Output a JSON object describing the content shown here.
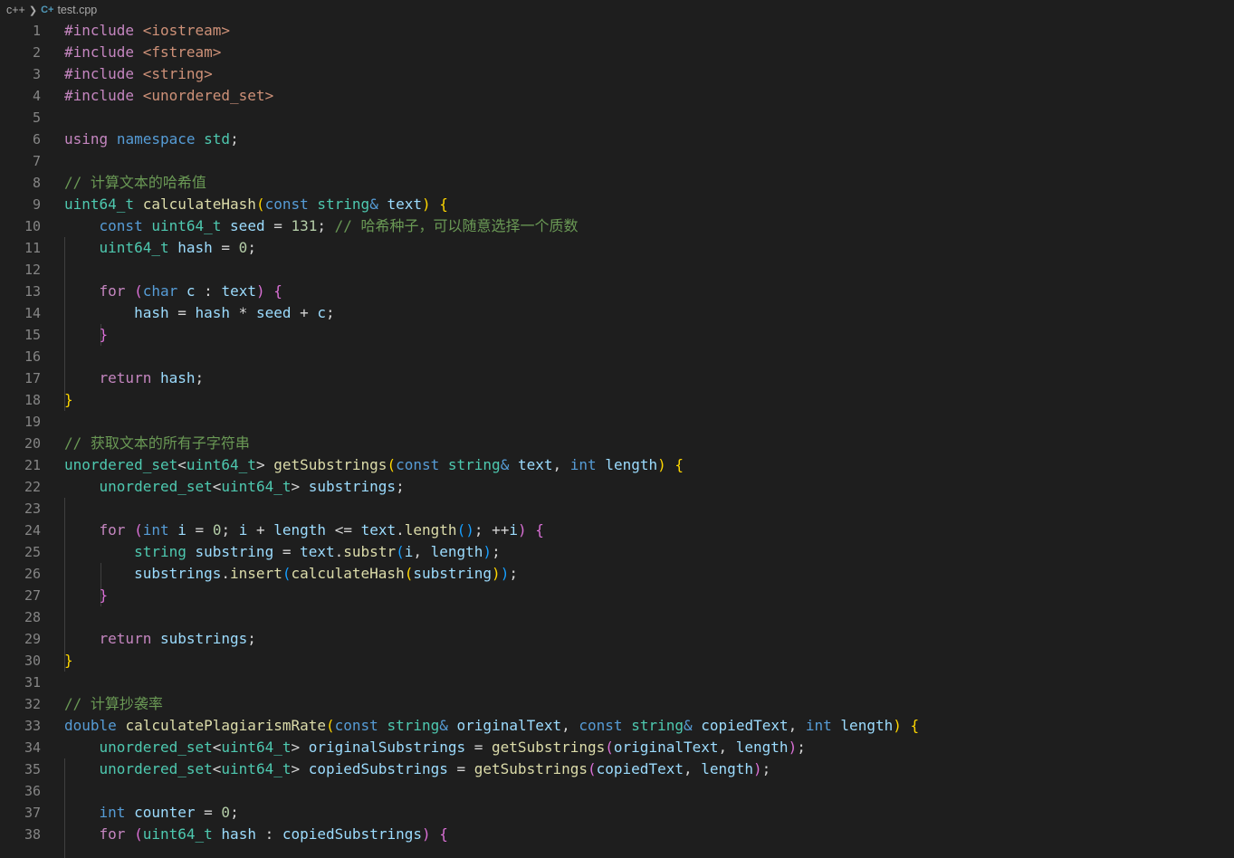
{
  "breadcrumb": {
    "folder": "c++",
    "file": "test.cpp"
  },
  "colors": {
    "background": "#1e1e1e",
    "keyword": "#569cd6",
    "control": "#c586c0",
    "type": "#4ec9b0",
    "function": "#dcdcaa",
    "variable": "#9cdcfe",
    "number": "#b5cea8",
    "string": "#ce9178",
    "comment": "#6a9955",
    "plain": "#d4d4d4"
  },
  "editor": {
    "lines": [
      {
        "n": "1",
        "tokens": [
          [
            "ctl",
            "#include"
          ],
          [
            "pl",
            " "
          ],
          [
            "str",
            "<iostream>"
          ]
        ]
      },
      {
        "n": "2",
        "tokens": [
          [
            "ctl",
            "#include"
          ],
          [
            "pl",
            " "
          ],
          [
            "str",
            "<fstream>"
          ]
        ]
      },
      {
        "n": "3",
        "tokens": [
          [
            "ctl",
            "#include"
          ],
          [
            "pl",
            " "
          ],
          [
            "str",
            "<string>"
          ]
        ]
      },
      {
        "n": "4",
        "tokens": [
          [
            "ctl",
            "#include"
          ],
          [
            "pl",
            " "
          ],
          [
            "str",
            "<unordered_set>"
          ]
        ]
      },
      {
        "n": "5",
        "tokens": []
      },
      {
        "n": "6",
        "tokens": [
          [
            "ctl",
            "using"
          ],
          [
            "pl",
            " "
          ],
          [
            "kw",
            "namespace"
          ],
          [
            "pl",
            " "
          ],
          [
            "type",
            "std"
          ],
          [
            "pl",
            ";"
          ]
        ]
      },
      {
        "n": "7",
        "tokens": []
      },
      {
        "n": "8",
        "tokens": [
          [
            "com",
            "// 计算文本的哈希值"
          ]
        ]
      },
      {
        "n": "9",
        "tokens": [
          [
            "type",
            "uint64_t"
          ],
          [
            "pl",
            " "
          ],
          [
            "fn",
            "calculateHash"
          ],
          [
            "b1",
            "("
          ],
          [
            "kw",
            "const"
          ],
          [
            "pl",
            " "
          ],
          [
            "type",
            "string"
          ],
          [
            "kw",
            "&"
          ],
          [
            "pl",
            " "
          ],
          [
            "var",
            "text"
          ],
          [
            "b1",
            ")"
          ],
          [
            "pl",
            " "
          ],
          [
            "b1",
            "{"
          ]
        ]
      },
      {
        "n": "10",
        "tokens": [
          [
            "pl",
            "    "
          ],
          [
            "kw",
            "const"
          ],
          [
            "pl",
            " "
          ],
          [
            "type",
            "uint64_t"
          ],
          [
            "pl",
            " "
          ],
          [
            "var",
            "seed"
          ],
          [
            "pl",
            " = "
          ],
          [
            "num",
            "131"
          ],
          [
            "pl",
            "; "
          ],
          [
            "com",
            "// 哈希种子，可以随意选择一个质数"
          ]
        ]
      },
      {
        "n": "11",
        "tokens": [
          [
            "pl",
            "    "
          ],
          [
            "type",
            "uint64_t"
          ],
          [
            "pl",
            " "
          ],
          [
            "var",
            "hash"
          ],
          [
            "pl",
            " = "
          ],
          [
            "num",
            "0"
          ],
          [
            "pl",
            ";"
          ]
        ]
      },
      {
        "n": "12",
        "tokens": []
      },
      {
        "n": "13",
        "tokens": [
          [
            "pl",
            "    "
          ],
          [
            "ctl",
            "for"
          ],
          [
            "pl",
            " "
          ],
          [
            "b2",
            "("
          ],
          [
            "kw",
            "char"
          ],
          [
            "pl",
            " "
          ],
          [
            "var",
            "c"
          ],
          [
            "pl",
            " : "
          ],
          [
            "var",
            "text"
          ],
          [
            "b2",
            ")"
          ],
          [
            "pl",
            " "
          ],
          [
            "b2",
            "{"
          ]
        ]
      },
      {
        "n": "14",
        "tokens": [
          [
            "pl",
            "        "
          ],
          [
            "var",
            "hash"
          ],
          [
            "pl",
            " = "
          ],
          [
            "var",
            "hash"
          ],
          [
            "pl",
            " * "
          ],
          [
            "var",
            "seed"
          ],
          [
            "pl",
            " + "
          ],
          [
            "var",
            "c"
          ],
          [
            "pl",
            ";"
          ]
        ]
      },
      {
        "n": "15",
        "tokens": [
          [
            "pl",
            "    "
          ],
          [
            "b2",
            "}"
          ]
        ]
      },
      {
        "n": "16",
        "tokens": []
      },
      {
        "n": "17",
        "tokens": [
          [
            "pl",
            "    "
          ],
          [
            "ctl",
            "return"
          ],
          [
            "pl",
            " "
          ],
          [
            "var",
            "hash"
          ],
          [
            "pl",
            ";"
          ]
        ]
      },
      {
        "n": "18",
        "tokens": [
          [
            "b1",
            "}"
          ]
        ]
      },
      {
        "n": "19",
        "tokens": []
      },
      {
        "n": "20",
        "tokens": [
          [
            "com",
            "// 获取文本的所有子字符串"
          ]
        ]
      },
      {
        "n": "21",
        "tokens": [
          [
            "type",
            "unordered_set"
          ],
          [
            "pl",
            "<"
          ],
          [
            "type",
            "uint64_t"
          ],
          [
            "pl",
            "> "
          ],
          [
            "fn",
            "getSubstrings"
          ],
          [
            "b1",
            "("
          ],
          [
            "kw",
            "const"
          ],
          [
            "pl",
            " "
          ],
          [
            "type",
            "string"
          ],
          [
            "kw",
            "&"
          ],
          [
            "pl",
            " "
          ],
          [
            "var",
            "text"
          ],
          [
            "pl",
            ", "
          ],
          [
            "kw",
            "int"
          ],
          [
            "pl",
            " "
          ],
          [
            "var",
            "length"
          ],
          [
            "b1",
            ")"
          ],
          [
            "pl",
            " "
          ],
          [
            "b1",
            "{"
          ]
        ]
      },
      {
        "n": "22",
        "tokens": [
          [
            "pl",
            "    "
          ],
          [
            "type",
            "unordered_set"
          ],
          [
            "pl",
            "<"
          ],
          [
            "type",
            "uint64_t"
          ],
          [
            "pl",
            "> "
          ],
          [
            "var",
            "substrings"
          ],
          [
            "pl",
            ";"
          ]
        ]
      },
      {
        "n": "23",
        "tokens": []
      },
      {
        "n": "24",
        "tokens": [
          [
            "pl",
            "    "
          ],
          [
            "ctl",
            "for"
          ],
          [
            "pl",
            " "
          ],
          [
            "b2",
            "("
          ],
          [
            "kw",
            "int"
          ],
          [
            "pl",
            " "
          ],
          [
            "var",
            "i"
          ],
          [
            "pl",
            " = "
          ],
          [
            "num",
            "0"
          ],
          [
            "pl",
            "; "
          ],
          [
            "var",
            "i"
          ],
          [
            "pl",
            " + "
          ],
          [
            "var",
            "length"
          ],
          [
            "pl",
            " <= "
          ],
          [
            "var",
            "text"
          ],
          [
            "pl",
            "."
          ],
          [
            "fn",
            "length"
          ],
          [
            "b3",
            "()"
          ],
          [
            "pl",
            "; ++"
          ],
          [
            "var",
            "i"
          ],
          [
            "b2",
            ")"
          ],
          [
            "pl",
            " "
          ],
          [
            "b2",
            "{"
          ]
        ]
      },
      {
        "n": "25",
        "tokens": [
          [
            "pl",
            "        "
          ],
          [
            "type",
            "string"
          ],
          [
            "pl",
            " "
          ],
          [
            "var",
            "substring"
          ],
          [
            "pl",
            " = "
          ],
          [
            "var",
            "text"
          ],
          [
            "pl",
            "."
          ],
          [
            "fn",
            "substr"
          ],
          [
            "b3",
            "("
          ],
          [
            "var",
            "i"
          ],
          [
            "pl",
            ", "
          ],
          [
            "var",
            "length"
          ],
          [
            "b3",
            ")"
          ],
          [
            "pl",
            ";"
          ]
        ]
      },
      {
        "n": "26",
        "tokens": [
          [
            "pl",
            "        "
          ],
          [
            "var",
            "substrings"
          ],
          [
            "pl",
            "."
          ],
          [
            "fn",
            "insert"
          ],
          [
            "b3",
            "("
          ],
          [
            "fn",
            "calculateHash"
          ],
          [
            "b1",
            "("
          ],
          [
            "var",
            "substring"
          ],
          [
            "b1",
            ")"
          ],
          [
            "b3",
            ")"
          ],
          [
            "pl",
            ";"
          ]
        ]
      },
      {
        "n": "27",
        "tokens": [
          [
            "pl",
            "    "
          ],
          [
            "b2",
            "}"
          ]
        ]
      },
      {
        "n": "28",
        "tokens": []
      },
      {
        "n": "29",
        "tokens": [
          [
            "pl",
            "    "
          ],
          [
            "ctl",
            "return"
          ],
          [
            "pl",
            " "
          ],
          [
            "var",
            "substrings"
          ],
          [
            "pl",
            ";"
          ]
        ]
      },
      {
        "n": "30",
        "tokens": [
          [
            "b1",
            "}"
          ]
        ]
      },
      {
        "n": "31",
        "tokens": []
      },
      {
        "n": "32",
        "tokens": [
          [
            "com",
            "// 计算抄袭率"
          ]
        ]
      },
      {
        "n": "33",
        "tokens": [
          [
            "kw",
            "double"
          ],
          [
            "pl",
            " "
          ],
          [
            "fn",
            "calculatePlagiarismRate"
          ],
          [
            "b1",
            "("
          ],
          [
            "kw",
            "const"
          ],
          [
            "pl",
            " "
          ],
          [
            "type",
            "string"
          ],
          [
            "kw",
            "&"
          ],
          [
            "pl",
            " "
          ],
          [
            "var",
            "originalText"
          ],
          [
            "pl",
            ", "
          ],
          [
            "kw",
            "const"
          ],
          [
            "pl",
            " "
          ],
          [
            "type",
            "string"
          ],
          [
            "kw",
            "&"
          ],
          [
            "pl",
            " "
          ],
          [
            "var",
            "copiedText"
          ],
          [
            "pl",
            ", "
          ],
          [
            "kw",
            "int"
          ],
          [
            "pl",
            " "
          ],
          [
            "var",
            "length"
          ],
          [
            "b1",
            ")"
          ],
          [
            "pl",
            " "
          ],
          [
            "b1",
            "{"
          ]
        ]
      },
      {
        "n": "34",
        "tokens": [
          [
            "pl",
            "    "
          ],
          [
            "type",
            "unordered_set"
          ],
          [
            "pl",
            "<"
          ],
          [
            "type",
            "uint64_t"
          ],
          [
            "pl",
            "> "
          ],
          [
            "var",
            "originalSubstrings"
          ],
          [
            "pl",
            " = "
          ],
          [
            "fn",
            "getSubstrings"
          ],
          [
            "b2",
            "("
          ],
          [
            "var",
            "originalText"
          ],
          [
            "pl",
            ", "
          ],
          [
            "var",
            "length"
          ],
          [
            "b2",
            ")"
          ],
          [
            "pl",
            ";"
          ]
        ]
      },
      {
        "n": "35",
        "tokens": [
          [
            "pl",
            "    "
          ],
          [
            "type",
            "unordered_set"
          ],
          [
            "pl",
            "<"
          ],
          [
            "type",
            "uint64_t"
          ],
          [
            "pl",
            "> "
          ],
          [
            "var",
            "copiedSubstrings"
          ],
          [
            "pl",
            " = "
          ],
          [
            "fn",
            "getSubstrings"
          ],
          [
            "b2",
            "("
          ],
          [
            "var",
            "copiedText"
          ],
          [
            "pl",
            ", "
          ],
          [
            "var",
            "length"
          ],
          [
            "b2",
            ")"
          ],
          [
            "pl",
            ";"
          ]
        ]
      },
      {
        "n": "36",
        "tokens": []
      },
      {
        "n": "37",
        "tokens": [
          [
            "pl",
            "    "
          ],
          [
            "kw",
            "int"
          ],
          [
            "pl",
            " "
          ],
          [
            "var",
            "counter"
          ],
          [
            "pl",
            " = "
          ],
          [
            "num",
            "0"
          ],
          [
            "pl",
            ";"
          ]
        ]
      },
      {
        "n": "38",
        "tokens": [
          [
            "pl",
            "    "
          ],
          [
            "ctl",
            "for"
          ],
          [
            "pl",
            " "
          ],
          [
            "b2",
            "("
          ],
          [
            "type",
            "uint64_t"
          ],
          [
            "pl",
            " "
          ],
          [
            "var",
            "hash"
          ],
          [
            "pl",
            " : "
          ],
          [
            "var",
            "copiedSubstrings"
          ],
          [
            "b2",
            ")"
          ],
          [
            "pl",
            " "
          ],
          [
            "b2",
            "{"
          ]
        ]
      }
    ]
  }
}
